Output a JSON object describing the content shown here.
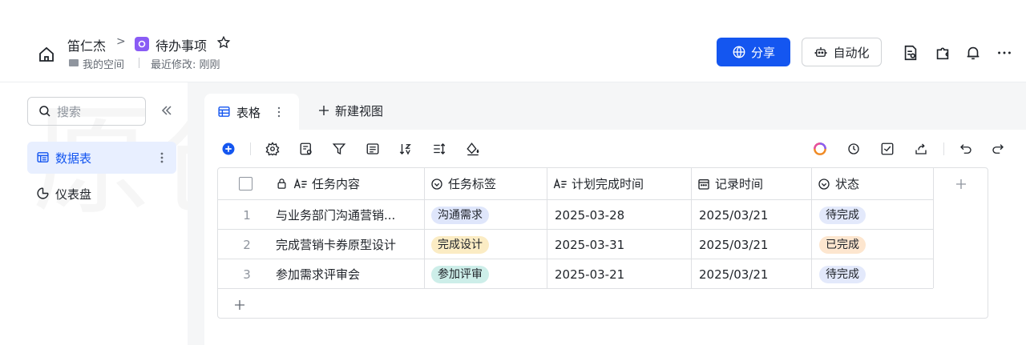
{
  "header": {
    "breadcrumb_user": "笛仁杰",
    "breadcrumb_sep": ">",
    "doc_title": "待办事项",
    "space_label": "我的空间",
    "modified_label": "最近修改: 刚刚",
    "share_label": "分享",
    "automation_label": "自动化"
  },
  "sidebar": {
    "search_placeholder": "搜索",
    "items": [
      {
        "label": "数据表",
        "icon": "table-icon",
        "active": true
      },
      {
        "label": "仪表盘",
        "icon": "dashboard-icon",
        "active": false
      }
    ]
  },
  "views": {
    "active_tab": "表格",
    "new_view": "新建视图"
  },
  "table": {
    "columns": [
      {
        "label": "任务内容",
        "icon": "text-icon"
      },
      {
        "label": "任务标签",
        "icon": "select-icon"
      },
      {
        "label": "计划完成时间",
        "icon": "text-icon"
      },
      {
        "label": "记录时间",
        "icon": "calendar-icon"
      },
      {
        "label": "状态",
        "icon": "select-icon"
      }
    ],
    "rows": [
      {
        "num": "1",
        "content": "与业务部门沟通营销...",
        "tag": "沟通需求",
        "plan": "2025-03-28",
        "recorded": "2025/03/21",
        "status": "待完成"
      },
      {
        "num": "2",
        "content": "完成营销卡券原型设计",
        "tag": "完成设计",
        "plan": "2025-03-31",
        "recorded": "2025/03/21",
        "status": "已完成"
      },
      {
        "num": "3",
        "content": "参加需求评审会",
        "tag": "参加评审",
        "plan": "2025-03-21",
        "recorded": "2025/03/21",
        "status": "待完成"
      }
    ],
    "add_row": "+",
    "add_col": "+"
  },
  "colors": {
    "primary": "#1456f0",
    "tag_communicate": "#dfe6fb",
    "tag_design": "#fbecc4",
    "tag_review": "#cdeee9",
    "status_pending": "#e3e9fb",
    "status_done": "#fde6cf"
  },
  "watermark": "原创内容BY笛仁杰"
}
